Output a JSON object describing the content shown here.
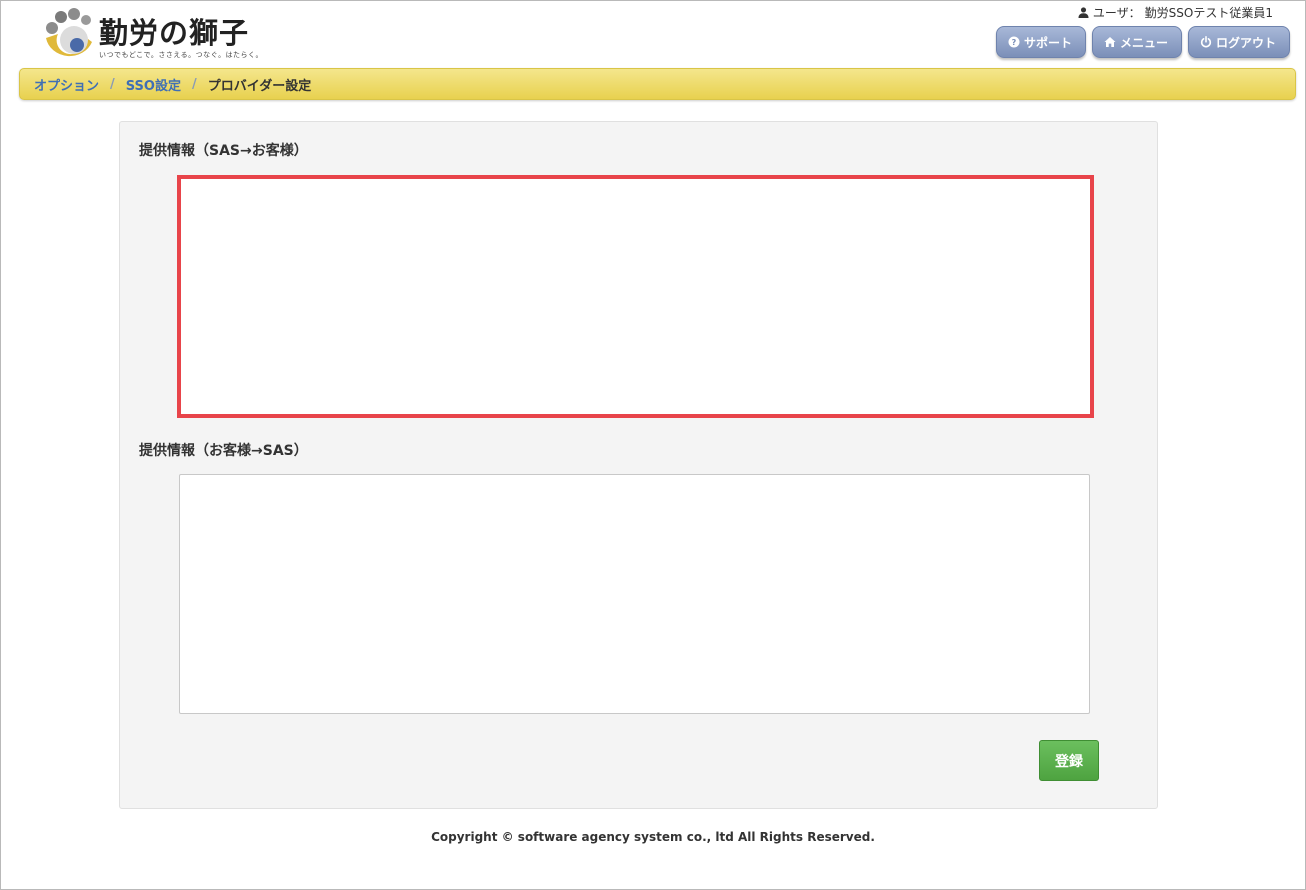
{
  "header": {
    "logo_title": "勤労の獅子",
    "logo_tagline": "いつでもどこで。ささえる。つなぐ。はたらく。",
    "user_label": "ユーザ：",
    "user_name": "勤労SSOテスト従業員1",
    "nav": {
      "support_label": "サポート",
      "menu_label": "メニュー",
      "logout_label": "ログアウト"
    }
  },
  "breadcrumb": {
    "items": [
      {
        "label": "オプション"
      },
      {
        "label": "SSO設定"
      },
      {
        "label": "プロバイダー設定"
      }
    ],
    "separator": "/"
  },
  "form": {
    "section1_label": "提供情報（SAS→お客様）",
    "section2_label": "提供情報（お客様→SAS）",
    "register_label": "登録"
  },
  "footer": {
    "copyright": "Copyright © software agency system co., ltd All Rights Reserved."
  },
  "colors": {
    "accent": "#3f6fb5",
    "breadcrumb_bg": "#f4e68c",
    "highlight_border": "#e8444a",
    "register_green": "#5cb85c",
    "nav_button": "#8a9dc4"
  }
}
